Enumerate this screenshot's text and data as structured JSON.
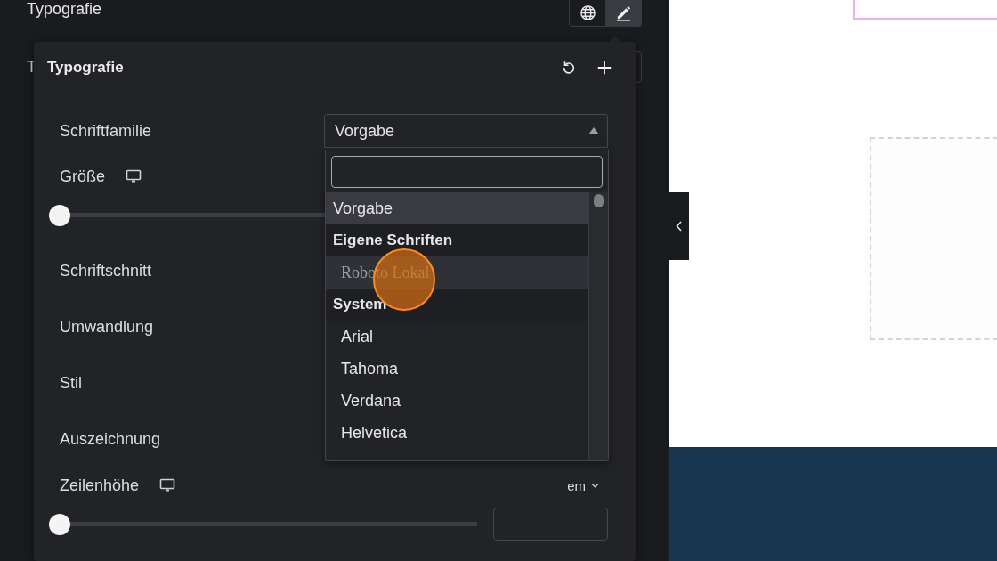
{
  "panel": {
    "title": "Typografie",
    "covered_label": "T",
    "mode_buttons": [
      {
        "kind": "globe",
        "selected": false
      },
      {
        "kind": "pencil",
        "selected": true
      }
    ]
  },
  "popover": {
    "title": "Typografie"
  },
  "fields": [
    {
      "kind": "select",
      "label": "Schriftfamilie",
      "value": "Vorgabe",
      "expanded": true
    },
    {
      "kind": "slider",
      "label": "Größe",
      "responsive": true,
      "level": 0
    },
    {
      "kind": "label",
      "label": "Schriftschnitt"
    },
    {
      "kind": "label",
      "label": "Umwandlung"
    },
    {
      "kind": "label",
      "label": "Stil"
    },
    {
      "kind": "label",
      "label": "Auszeichnung"
    },
    {
      "kind": "slider",
      "label": "Zeilenhöhe",
      "responsive": true,
      "unit": "em",
      "level": 0
    }
  ],
  "dropdown": {
    "options": [
      {
        "kind": "option",
        "label": "Vorgabe",
        "selected": true,
        "hovered": false
      },
      {
        "kind": "group",
        "label": "Eigene Schriften"
      },
      {
        "kind": "custom",
        "label": "Roboto Lokal",
        "selected": false,
        "hovered": true
      },
      {
        "kind": "group",
        "label": "System"
      },
      {
        "kind": "option",
        "label": "Arial",
        "selected": false,
        "hovered": false
      },
      {
        "kind": "option",
        "label": "Tahoma",
        "selected": false,
        "hovered": false
      },
      {
        "kind": "option",
        "label": "Verdana",
        "selected": false,
        "hovered": false
      },
      {
        "kind": "option",
        "label": "Helvetica",
        "selected": false,
        "hovered": false
      }
    ]
  }
}
